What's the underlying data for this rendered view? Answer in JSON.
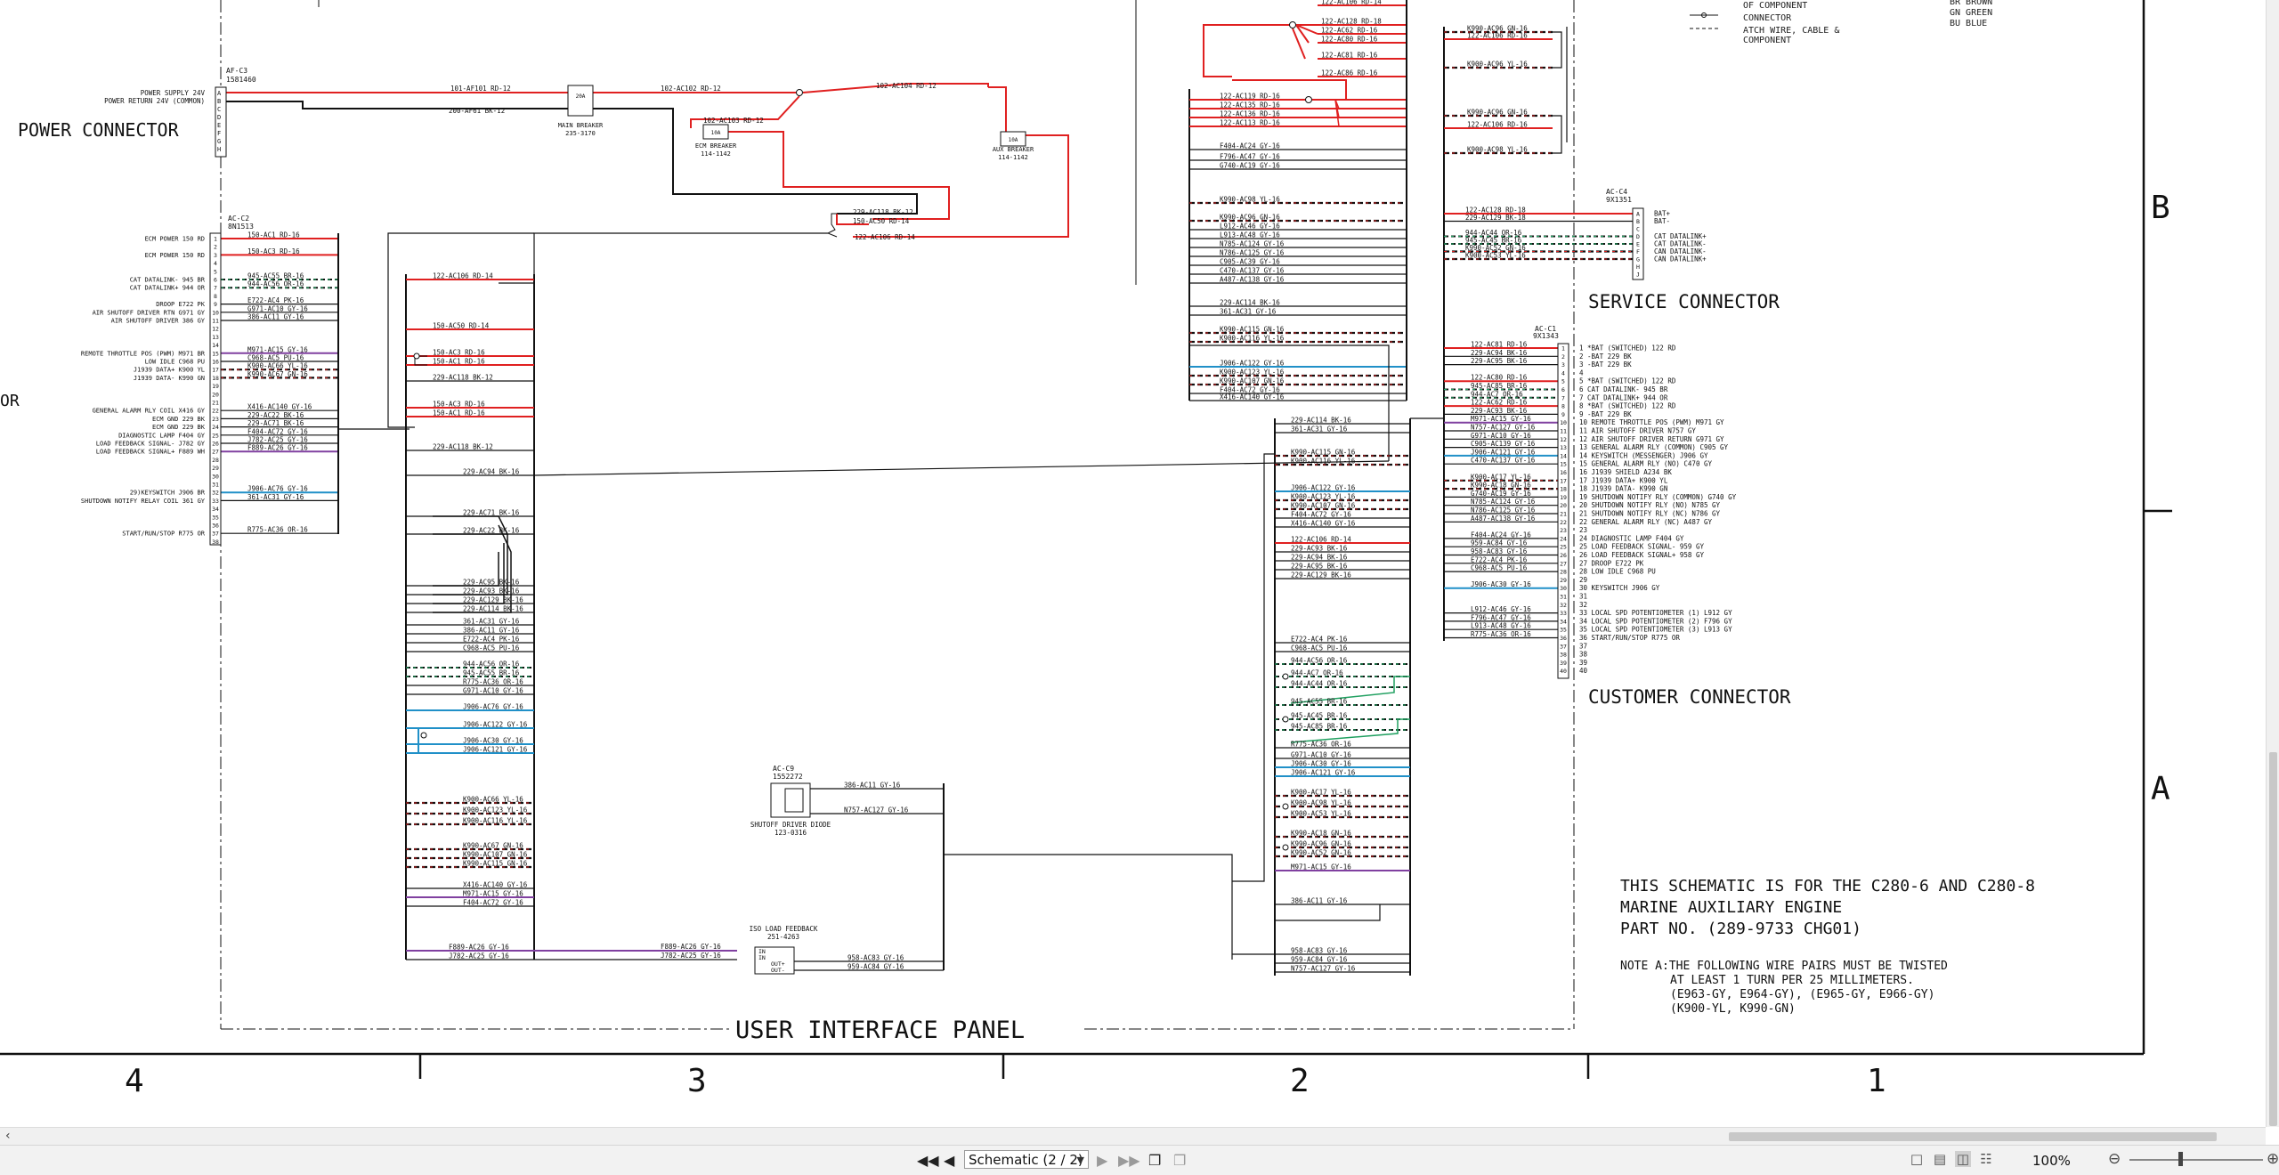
{
  "viewer": {
    "page_select": "Schematic (2 / 2)",
    "zoom": "100%",
    "icons": {
      "first": "first-page-icon",
      "prev": "previous-page-icon",
      "next": "next-page-icon",
      "last": "last-page-icon",
      "copy": "copy-icon",
      "paste": "paste-icon",
      "zoom_out": "zoom-out-icon",
      "zoom_in": "zoom-in-icon"
    },
    "colors": {
      "red": "#e02020",
      "blue": "#2090c8",
      "purple": "#8040a0",
      "green": "#20a060"
    }
  },
  "zones": {
    "columns": [
      "4",
      "3",
      "2",
      "1"
    ],
    "rows": [
      "B",
      "A"
    ]
  },
  "headings": {
    "power_connector": "POWER CONNECTOR",
    "service_connector": "SERVICE CONNECTOR",
    "customer_connector": "CUSTOMER CONNECTOR",
    "user_interface_panel": "USER INTERFACE PANEL",
    "cut_left": "OR"
  },
  "legend": {
    "items": [
      "OF COMPONENT",
      "CONNECTOR",
      "ATCH WIRE, CABLE &",
      "COMPONENT"
    ],
    "colors": [
      "BR   BROWN",
      "GN   GREEN",
      "BU   BLUE"
    ]
  },
  "notes": {
    "line1": "THIS SCHEMATIC IS FOR THE C280-6 AND C280-8",
    "line2": "MARINE AUXILIARY ENGINE",
    "line3": "PART NO. (289-9733 CHG01)",
    "note_a": "NOTE A:THE FOLLOWING WIRE PAIRS MUST BE TWISTED",
    "note_a2": "AT LEAST 1 TURN PER 25 MILLIMETERS.",
    "note_a3": "(E963-GY, E964-GY), (E965-GY, E966-GY)",
    "note_a4": "(K900-YL, K990-GN)"
  },
  "components": {
    "af_c3": {
      "id": "AF-C3",
      "part": "1581460"
    },
    "ac_c2": {
      "id": "AC-C2",
      "part": "8N1513"
    },
    "ac_c4": {
      "id": "AC-C4",
      "part": "9X1351"
    },
    "ac_c1": {
      "id": "AC-C1",
      "part": "9X1343"
    },
    "ac_c9": {
      "id": "AC-C9",
      "part": "1552272"
    },
    "main_breaker": {
      "name": "MAIN BREAKER",
      "part": "235-3170",
      "rating": "20A"
    },
    "ecm_breaker": {
      "name": "ECM BREAKER",
      "part": "114-1142",
      "rating": "10A"
    },
    "aux_breaker": {
      "name": "AUX BREAKER",
      "part": "114-1142",
      "rating": "10A"
    },
    "diode": {
      "name": "SHUTOFF DRIVER DIODE",
      "part": "123-0316"
    },
    "iso": {
      "name": "ISO LOAD FEEDBACK",
      "part": "251-4263",
      "pins": [
        "IN",
        "IN",
        "OUT+",
        "OUT-"
      ]
    }
  },
  "power_labels": [
    "POWER SUPPLY 24V",
    "POWER RETURN 24V (COMMON)"
  ],
  "power_pins": [
    "A",
    "B",
    "C",
    "D",
    "E",
    "F",
    "G",
    "H"
  ],
  "power_wires": [
    "101-AF101 RD-12",
    "200-AF61 BK-12",
    "102-AC102 RD-12",
    "102-AC104 RD-12",
    "102-AC103 RD-12",
    "229-AC118 BK-12",
    "150-AC50 RD-14",
    "122-AC106 RD-14"
  ],
  "ac_c2_labels": [
    "ECM POWER 150 RD",
    "",
    "ECM POWER 150 RD",
    "",
    "",
    "CAT DATALINK- 945 BR",
    "CAT DATALINK+ 944 OR",
    "",
    "DROOP E722 PK",
    "AIR SHUTOFF DRIVER RTN G971 GY",
    "AIR SHUTOFF DRIVER 386 GY",
    "",
    "",
    "",
    "REMOTE THROTTLE POS (PWM) M971 BR",
    "LOW IDLE C968 PU",
    "J1939 DATA+ K900 YL",
    "J1939 DATA- K990 GN",
    "",
    "",
    "",
    "GENERAL ALARM RLY COIL X416 GY",
    "ECM GND 229 BK",
    "ECM GND 229 BK",
    "DIAGNOSTIC LAMP F404 GY",
    "LOAD FEEDBACK SIGNAL- J782 GY",
    "LOAD FEEDBACK SIGNAL+ F889 WH",
    "",
    "",
    "",
    "",
    "29)KEYSWITCH J906 BR",
    "SHUTDOWN NOTIFY RELAY COIL 361 GY",
    "",
    "",
    "",
    "START/RUN/STOP R775 OR",
    ""
  ],
  "ac_c2_wires": [
    "150-AC1 RD-16",
    "",
    "150-AC3 RD-16",
    "",
    "",
    "945-AC55 BR-16",
    "944-AC56 OR-16",
    "",
    "E722-AC4 PK-16",
    "G971-AC10 GY-16",
    "386-AC11 GY-16",
    "",
    "",
    "",
    "M971-AC15 GY-16",
    "C968-AC5 PU-16",
    "K900-AC66 YL-16",
    "K990-AC67 GN-16",
    "",
    "",
    "",
    "X416-AC140 GY-16",
    "229-AC22 BK-16",
    "229-AC71 BK-16",
    "F404-AC72 GY-16",
    "J782-AC25 GY-16",
    "F889-AC26 GY-16",
    "",
    "",
    "",
    "",
    "J906-AC76 GY-16",
    "361-AC31 GY-16",
    "",
    "",
    "",
    "R775-AC36 OR-16",
    ""
  ],
  "panel3_wires": [
    "122-AC106 RD-14",
    "150-AC50 RD-14",
    "150-AC3 RD-16",
    "150-AC1 RD-16",
    "229-AC118 BK-12",
    "150-AC3 RD-16",
    "150-AC1 RD-16",
    "229-AC118 BK-12",
    "229-AC94 BK-16",
    "229-AC71 BK-16",
    "229-AC22 BK-16",
    "229-AC95 BK-16",
    "229-AC93 BK-16",
    "229-AC129 BK-16",
    "229-AC114 BK-16",
    "361-AC31 GY-16",
    "386-AC11 GY-16",
    "E722-AC4 PK-16",
    "C968-AC5 PU-16",
    "944-AC56 OR-16",
    "945-AC55 BR-16",
    "R775-AC36 OR-16",
    "G971-AC10 GY-16",
    "J906-AC76 GY-16",
    "J906-AC122 GY-16",
    "J906-AC30 GY-16",
    "J906-AC121 GY-16",
    "K900-AC66 YL-16",
    "K900-AC123 YL-16",
    "K900-AC116 YL-16",
    "K990-AC67 GN-16",
    "K990-AC107 GN-16",
    "K990-AC115 GN-16",
    "X416-AC140 GY-16",
    "M971-AC15 GY-16",
    "F404-AC72 GY-16"
  ],
  "panel3_bottom": [
    "F889-AC26 GY-16",
    "J782-AC25 GY-16",
    "F889-AC26 GY-16",
    "J782-AC25 GY-16"
  ],
  "diode_wires": [
    "386-AC11 GY-16",
    "N757-AC127 GY-16"
  ],
  "iso_wires": [
    "958-AC83 GY-16",
    "959-AC84 GY-16"
  ],
  "col2_top": [
    "122-AC106 RD-14",
    "122-AC128 RD-18",
    "122-AC62 RD-16",
    "122-AC80 RD-16",
    "122-AC81 RD-16",
    "122-AC86 RD-16",
    "122-AC119 RD-16",
    "122-AC135 RD-16",
    "122-AC136 RD-16",
    "122-AC113 RD-16",
    "F404-AC24 GY-16",
    "F796-AC47 GY-16",
    "G740-AC19 GY-16",
    "K990-AC98 YL-16",
    "K990-AC96 GN-16",
    "L912-AC46 GY-16",
    "L913-AC48 GY-16",
    "N785-AC124 GY-16",
    "N786-AC125 GY-16",
    "C905-AC39 GY-16",
    "C470-AC137 GY-16",
    "A487-AC138 GY-16",
    "229-AC114 BK-16",
    "361-AC31 GY-16",
    "K990-AC115 GN-16",
    "K900-AC116 YL-16",
    "J906-AC122 GY-16",
    "K900-AC123 YL-16",
    "K990-AC107 GN-16",
    "F404-AC72 GY-16",
    "X416-AC140 GY-16"
  ],
  "col2_mid": [
    "229-AC114 BK-16",
    "361-AC31 GY-16",
    "K990-AC115 GN-16",
    "K900-AC116 YL-16",
    "J906-AC122 GY-16",
    "K900-AC123 YL-16",
    "K990-AC107 GN-16",
    "F404-AC72 GY-16",
    "X416-AC140 GY-16",
    "122-AC106 RD-14",
    "229-AC93 BK-16",
    "229-AC94 BK-16",
    "229-AC95 BK-16",
    "229-AC129 BK-16",
    "E722-AC4 PK-16",
    "C968-AC5 PU-16",
    "944-AC56 OR-16",
    "944-AC7 OR-16",
    "944-AC44 OR-16",
    "945-AC55 BR-16",
    "945-AC45 BR-16",
    "945-AC85 BR-16",
    "R775-AC36 OR-16",
    "G971-AC10 GY-16",
    "J906-AC30 GY-16",
    "J906-AC121 GY-16",
    "K900-AC17 YL-16",
    "K900-AC98 YL-16",
    "K900-AC53 YL-16",
    "K990-AC18 GN-16",
    "K990-AC96 GN-16",
    "K990-AC52 GN-16",
    "M971-AC15 GY-16",
    "386-AC11 GY-16",
    "958-AC83 GY-16",
    "959-AC84 GY-16",
    "N757-AC127 GY-16"
  ],
  "col1_top": [
    "K990-AC96 GN-16",
    "122-AC106 RD-16",
    "K900-AC96 YL-16",
    "K990-AC96 GN-16",
    "122-AC106 RD-16",
    "K900-AC98 YL-16"
  ],
  "ac_c4_wires": [
    "122-AC128 RD-18",
    "229-AC129 BK-18",
    "",
    "944-AC44 OR-16",
    "945-AC45 BR-16",
    "K990-AC52 GN-16",
    "K900-AC53 YL-16"
  ],
  "ac_c4_pins": [
    "A",
    "B",
    "C",
    "D",
    "E",
    "F",
    "G",
    "H",
    "J"
  ],
  "ac_c4_labels": [
    "BAT+",
    "BAT-",
    "",
    "CAT DATALINK+",
    "CAT DATALINK-",
    "CAN DATALINK-",
    "CAN DATALINK+",
    "",
    ""
  ],
  "ac_c1_wires": [
    "122-AC81 RD-16",
    "229-AC94 BK-16",
    "229-AC95 BK-16",
    "",
    "122-AC80 RD-16",
    "945-AC85 BR-16",
    "944-AC7 OR-16",
    "122-AC62 RD-16",
    "229-AC93 BK-16",
    "M971-AC15 GY-16",
    "N757-AC127 GY-16",
    "G971-AC10 GY-16",
    "C905-AC139 GY-16",
    "J906-AC121 GY-16",
    "C470-AC137 GY-16",
    "",
    "K900-AC17 YL-16",
    "K990-AC18 GN-16",
    "G740-AC19 GY-16",
    "N785-AC124 GY-16",
    "N786-AC125 GY-16",
    "A487-AC138 GY-16",
    "",
    "F404-AC24 GY-16",
    "959-AC84 GY-16",
    "958-AC83 GY-16",
    "E722-AC4 PK-16",
    "C968-AC5 PU-16",
    "",
    "J906-AC30 GY-16",
    "",
    "",
    "L912-AC46 GY-16",
    "F796-AC47 GY-16",
    "L913-AC48 GY-16",
    "R775-AC36 OR-16",
    "",
    "",
    ""
  ],
  "ac_c1_labels": [
    "1 *BAT (SWITCHED) 122 RD",
    "2 -BAT 229 BK",
    "3 -BAT 229 BK",
    "4",
    "5 *BAT (SWITCHED) 122 RD",
    "6 CAT DATALINK- 945 BR",
    "7 CAT DATALINK+ 944 OR",
    "8 *BAT (SWITCHED) 122 RD",
    "9 -BAT 229 BK",
    "10 REMOTE THROTTLE POS (PWM) M971 GY",
    "11 AIR SHUTOFF DRIVER N757 GY",
    "12 AIR SHUTOFF DRIVER RETURN G971 GY",
    "13 GENERAL ALARM RLY (COMMON) C905 GY",
    "14 KEYSWITCH (MESSENGER) J906 GY",
    "15 GENERAL ALARM RLY (NO) C470 GY",
    "16 J1939 SHIELD A234 BK",
    "17 J1939 DATA+ K900 YL",
    "18 J1939 DATA- K990 GN",
    "19 SHUTDOWN NOTIFY RLY (COMMON) G740 GY",
    "20 SHUTDOWN NOTIFY RLY (NO) N785 GY",
    "21 SHUTDOWN NOTIFY RLY (NC) N786 GY",
    "22 GENERAL ALARM RLY (NC) A487 GY",
    "23",
    "24 DIAGNOSTIC LAMP F404 GY",
    "25 LOAD FEEDBACK SIGNAL- 959 GY",
    "26 LOAD FEEDBACK SIGNAL+ 958 GY",
    "27 DROOP E722 PK",
    "28 LOW IDLE C968 PU",
    "29",
    "30 KEYSWITCH J906 GY",
    "31",
    "32",
    "33 LOCAL SPD POTENTIOMETER (1) L912 GY",
    "34 LOCAL SPD POTENTIOMETER (2) F796 GY",
    "35 LOCAL SPD POTENTIOMETER (3) L913 GY",
    "36 START/RUN/STOP R775 OR",
    "37",
    "38",
    "39",
    "40"
  ]
}
